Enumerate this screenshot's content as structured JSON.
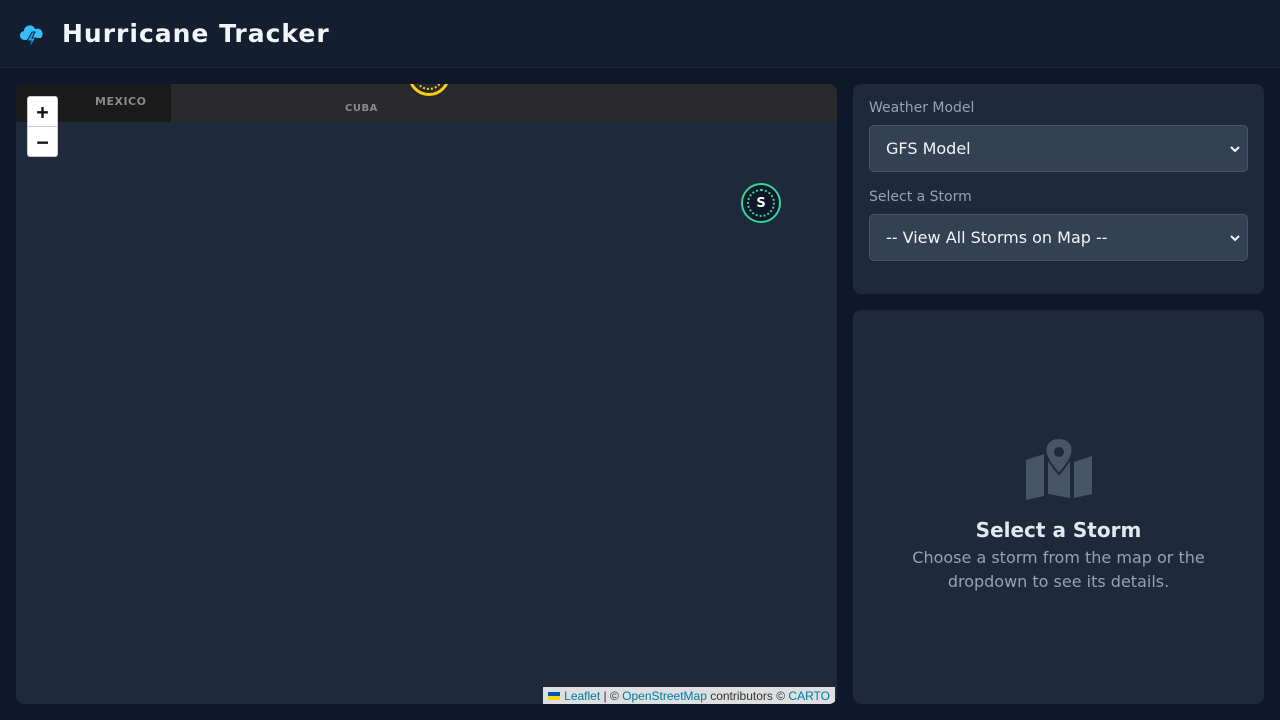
{
  "header": {
    "title": "Hurricane Tracker",
    "logo_icon": "storm-cloud-lightning-icon"
  },
  "map": {
    "labels": {
      "mexico": "MEXICO",
      "cuba": "CUBA"
    },
    "zoom_in": "+",
    "zoom_out": "−",
    "storm_marker_letter": "S",
    "attribution": {
      "leaflet": "Leaflet",
      "sep": " | © ",
      "osm": "OpenStreetMap",
      "contrib": " contributors © ",
      "carto": "CARTO"
    },
    "colors": {
      "storm": "#34d399",
      "highlight": "#facc15"
    }
  },
  "controls": {
    "model_label": "Weather Model",
    "model_value": "GFS Model",
    "storm_label": "Select a Storm",
    "storm_value": "-- View All Storms on Map --"
  },
  "detail": {
    "title": "Select a Storm",
    "text": "Choose a storm from the map or the dropdown to see its details."
  }
}
